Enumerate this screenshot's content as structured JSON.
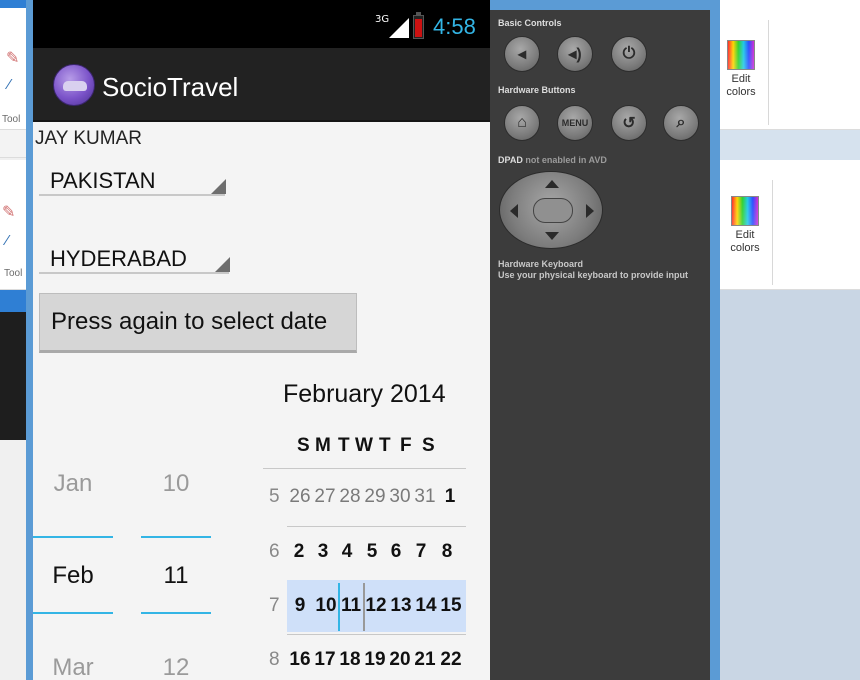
{
  "background_app": {
    "tools_label": "Tools",
    "tools_label_short": "Tool",
    "tools_label_partial": "Tool",
    "edit_colors_line1": "Edit",
    "edit_colors_line2": "colors"
  },
  "status_bar": {
    "network": "3G",
    "time": "4:58"
  },
  "action_bar": {
    "title": "SocioTravel"
  },
  "form": {
    "user_name": "JAY KUMAR",
    "country": "PAKISTAN",
    "city": "HYDERABAD",
    "date_button": "Press again to select date"
  },
  "date_picker": {
    "months": {
      "prev": "Jan",
      "selected": "Feb",
      "next": "Mar"
    },
    "days": {
      "prev": "10",
      "selected": "11",
      "next": "12"
    }
  },
  "calendar": {
    "title": "February 2014",
    "weekday_headers": [
      "S",
      "M",
      "T",
      "W",
      "T",
      "F",
      "S"
    ],
    "weeks": [
      {
        "week": "5",
        "days": [
          "26",
          "27",
          "28",
          "29",
          "30",
          "31",
          "1"
        ]
      },
      {
        "week": "6",
        "days": [
          "2",
          "3",
          "4",
          "5",
          "6",
          "7",
          "8"
        ]
      },
      {
        "week": "7",
        "days": [
          "9",
          "10",
          "11",
          "12",
          "13",
          "14",
          "15"
        ]
      },
      {
        "week": "8",
        "days": [
          "16",
          "17",
          "18",
          "19",
          "20",
          "21",
          "22"
        ]
      }
    ],
    "selected_week": "7",
    "selected_day": "11"
  },
  "emulator_controls": {
    "basic_controls_label": "Basic Controls",
    "hardware_buttons_label": "Hardware Buttons",
    "menu_label": "MENU",
    "dpad_label": "DPAD",
    "dpad_status": "not enabled in AVD",
    "keyboard_title": "Hardware Keyboard",
    "keyboard_note": "Use your physical keyboard to provide input"
  }
}
